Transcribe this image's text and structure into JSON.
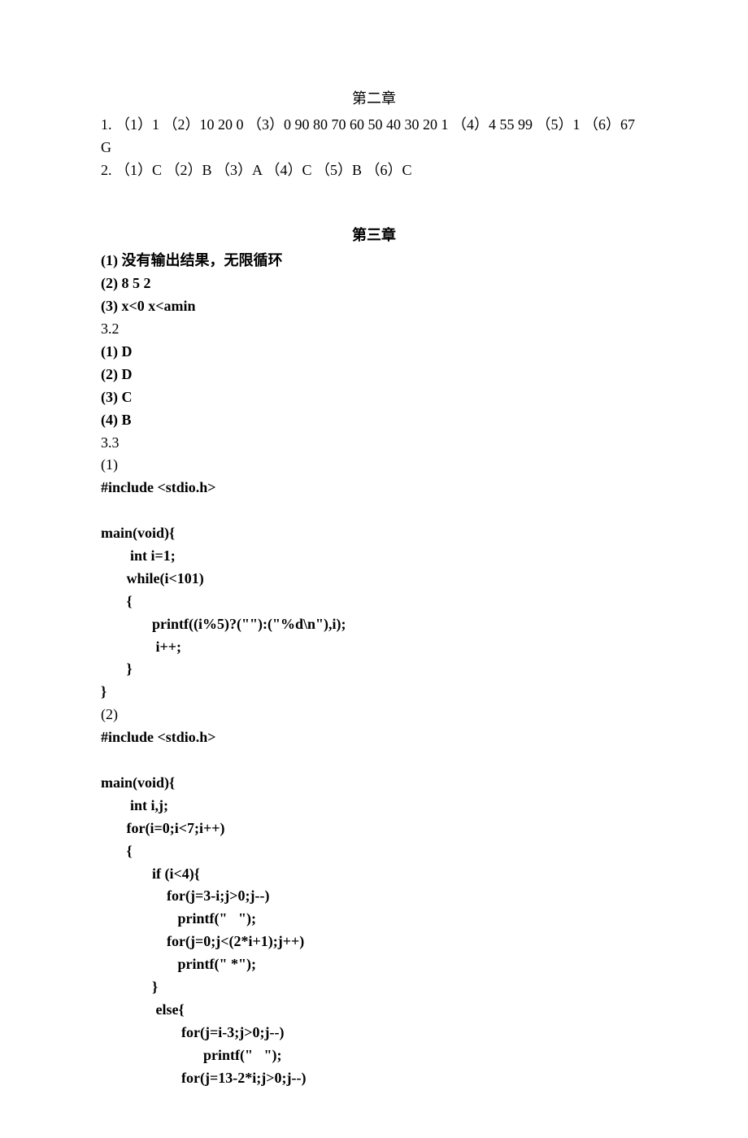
{
  "chapter2": {
    "title": "第二章",
    "q1": "1. （1）1 （2）10 20 0 （3）0 90 80 70 60 50 40 30 20 1 （4）4 55 99  （5）1  （6）67 G",
    "q2": "2. （1）C （2）B （3）A （4）C （5）B （6）C"
  },
  "chapter3": {
    "title": "第三章",
    "l1": "(1) 没有输出结果，无限循环",
    "l2": "(2) 8   5   2",
    "l3": "(3) x<0   x<amin",
    "l4": "3.2",
    "l5": "(1) D",
    "l6": "(2) D",
    "l7": "(3) C",
    "l8": "(4) B",
    "l9": "3.3",
    "l10": "(1)",
    "code1": "#include <stdio.h>\n\nmain(void){\n        int i=1;\n       while(i<101)\n       {\n              printf((i%5)?(\"\"):(\"%d\\n\"),i);\n               i++;\n       }\n}",
    "l11": "(2)",
    "code2": "#include <stdio.h>\n\nmain(void){\n        int i,j;\n       for(i=0;i<7;i++)\n       {\n              if (i<4){\n                  for(j=3-i;j>0;j--)\n                     printf(\"   \");\n                  for(j=0;j<(2*i+1);j++)\n                     printf(\" *\");\n              }\n               else{\n                      for(j=i-3;j>0;j--)\n                            printf(\"   \");\n                      for(j=13-2*i;j>0;j--)"
  }
}
